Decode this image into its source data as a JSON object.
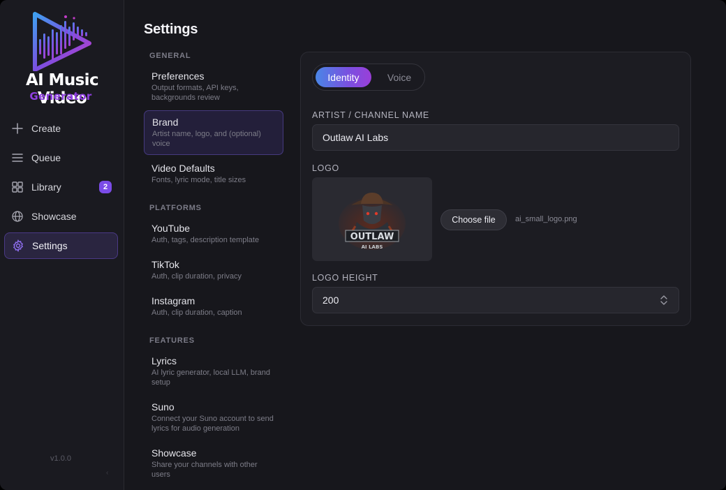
{
  "app": {
    "name_line1": "AI Music Video",
    "name_line2": "Generator",
    "version": "v1.0.0",
    "collapse_glyph": "‹"
  },
  "nav": {
    "items": [
      {
        "label": "Create",
        "icon": "plus-icon"
      },
      {
        "label": "Queue",
        "icon": "list-icon"
      },
      {
        "label": "Library",
        "icon": "grid-icon",
        "badge": "2"
      },
      {
        "label": "Showcase",
        "icon": "globe-icon"
      },
      {
        "label": "Settings",
        "icon": "gear-icon",
        "active": true
      }
    ]
  },
  "page": {
    "title": "Settings"
  },
  "settings_nav": {
    "sections": [
      {
        "label": "GENERAL",
        "items": [
          {
            "title": "Preferences",
            "desc": "Output formats, API keys, backgrounds review"
          },
          {
            "title": "Brand",
            "desc": "Artist name, logo, and (optional) voice",
            "active": true
          },
          {
            "title": "Video Defaults",
            "desc": "Fonts, lyric mode, title sizes"
          }
        ]
      },
      {
        "label": "PLATFORMS",
        "items": [
          {
            "title": "YouTube",
            "desc": "Auth, tags, description template"
          },
          {
            "title": "TikTok",
            "desc": "Auth, clip duration, privacy"
          },
          {
            "title": "Instagram",
            "desc": "Auth, clip duration, caption"
          }
        ]
      },
      {
        "label": "FEATURES",
        "items": [
          {
            "title": "Lyrics",
            "desc": "AI lyric generator, local LLM, brand setup"
          },
          {
            "title": "Suno",
            "desc": "Connect your Suno account to send lyrics for audio generation"
          },
          {
            "title": "Showcase",
            "desc": "Share your channels with other users"
          }
        ]
      }
    ]
  },
  "brand": {
    "tabs": [
      {
        "label": "Identity",
        "active": true
      },
      {
        "label": "Voice"
      }
    ],
    "artist_label": "ARTIST / CHANNEL NAME",
    "artist_value": "Outlaw AI Labs",
    "logo_label": "LOGO",
    "logo_image_text": "OUTLAW",
    "logo_image_subtext": "AI LABS",
    "choose_file_label": "Choose file",
    "file_name": "ai_small_logo.png",
    "height_label": "LOGO HEIGHT",
    "height_value": "200"
  },
  "colors": {
    "accent": "#7b4ce8",
    "gradient_start": "#4a86e6",
    "gradient_end": "#9a3fd8",
    "background": "#17171c"
  }
}
